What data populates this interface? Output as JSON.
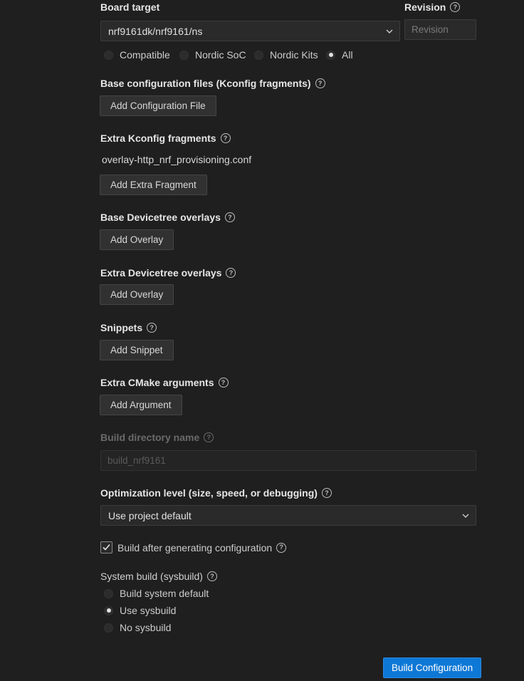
{
  "board_target": {
    "label": "Board target",
    "value": "nrf9161dk/nrf9161/ns",
    "filters": [
      {
        "label": "Compatible",
        "selected": false
      },
      {
        "label": "Nordic SoC",
        "selected": false
      },
      {
        "label": "Nordic Kits",
        "selected": false
      },
      {
        "label": "All",
        "selected": true
      }
    ]
  },
  "revision": {
    "label": "Revision",
    "placeholder": "Revision"
  },
  "base_config": {
    "label": "Base configuration files (Kconfig fragments)",
    "button": "Add Configuration File"
  },
  "extra_kconfig": {
    "label": "Extra Kconfig fragments",
    "items": [
      "overlay-http_nrf_provisioning.conf"
    ],
    "button": "Add Extra Fragment"
  },
  "base_devicetree": {
    "label": "Base Devicetree overlays",
    "button": "Add Overlay"
  },
  "extra_devicetree": {
    "label": "Extra Devicetree overlays",
    "button": "Add Overlay"
  },
  "snippets": {
    "label": "Snippets",
    "button": "Add Snippet"
  },
  "cmake_args": {
    "label": "Extra CMake arguments",
    "button": "Add Argument"
  },
  "build_dir": {
    "label": "Build directory name",
    "placeholder": "build_nrf9161"
  },
  "optimization": {
    "label": "Optimization level (size, speed, or debugging)",
    "value": "Use project default"
  },
  "build_after": {
    "label": "Build after generating configuration",
    "checked": true
  },
  "sysbuild": {
    "label": "System build (sysbuild)",
    "options": [
      {
        "label": "Build system default",
        "selected": false
      },
      {
        "label": "Use sysbuild",
        "selected": true
      },
      {
        "label": "No sysbuild",
        "selected": false
      }
    ]
  },
  "submit": {
    "label": "Build Configuration"
  },
  "colors": {
    "background": "#1f1f1f",
    "primary_button": "#0e78d6"
  }
}
